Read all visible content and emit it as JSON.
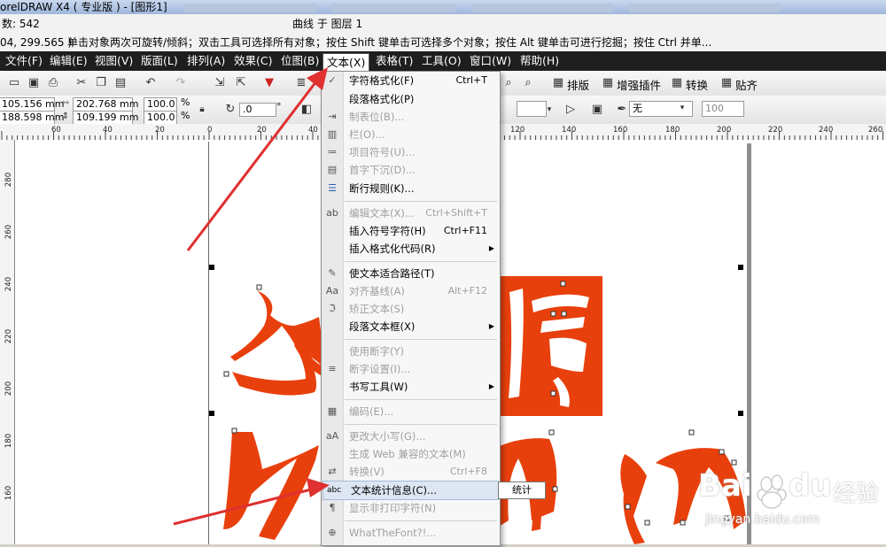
{
  "window": {
    "title": "orelDRAW X4 ( 专业版 ) - [图形1]",
    "layer_status": "曲线 于 图层 1"
  },
  "status": {
    "count_label": "数: 542",
    "coords": "04, 299.565 )",
    "hint": "单击对象两次可旋转/倾斜；双击工具可选择所有对象；按住 Shift 键单击可选择多个对象；按住 Alt 键单击可进行挖掘；按住 Ctrl 并单..."
  },
  "menubar": {
    "items": [
      "文件(F)",
      "编辑(E)",
      "视图(V)",
      "版面(L)",
      "排列(A)",
      "效果(C)",
      "位图(B)",
      "文本(X)",
      "表格(T)",
      "工具(O)",
      "窗口(W)",
      "帮助(H)"
    ],
    "active": "文本(X)"
  },
  "toolbar1": {
    "plugin_labels": [
      "排版",
      "增强插件",
      "转换",
      "贴齐"
    ]
  },
  "propbar": {
    "x": "105.156 mm",
    "y": "188.598 mm",
    "width": "202.768 mm",
    "height": "109.199 mm",
    "scale_x": "100.0",
    "scale_y": "100.0",
    "percent": "%",
    "rotation": ".0",
    "degree": "°",
    "outline_value": "无",
    "opacity_value": "100"
  },
  "ruler": {
    "h_labels": [
      "60",
      "40",
      "20",
      "0",
      "20",
      "40",
      "120",
      "140",
      "160",
      "180",
      "200",
      "220",
      "240",
      "260"
    ],
    "v_labels": [
      "280",
      "260",
      "240",
      "220",
      "200",
      "180",
      "160"
    ]
  },
  "text_menu": {
    "items": [
      {
        "label": "字符格式化(F)",
        "shortcut": "Ctrl+T",
        "disabled": false,
        "icon": "check-icon"
      },
      {
        "label": "段落格式化(P)",
        "shortcut": "",
        "disabled": false,
        "icon": ""
      },
      {
        "label": "制表位(B)...",
        "shortcut": "",
        "disabled": true,
        "icon": "tab-icon"
      },
      {
        "label": "栏(O)...",
        "shortcut": "",
        "disabled": true,
        "icon": "columns-icon"
      },
      {
        "label": "项目符号(U)...",
        "shortcut": "",
        "disabled": true,
        "icon": "bullets-icon"
      },
      {
        "label": "首字下沉(D)...",
        "shortcut": "",
        "disabled": true,
        "icon": "dropcap-icon"
      },
      {
        "label": "断行规则(K)...",
        "shortcut": "",
        "disabled": false,
        "icon": "linebreak-icon"
      },
      {
        "label": "编辑文本(X)...",
        "shortcut": "Ctrl+Shift+T",
        "disabled": true,
        "icon": "edit-text-icon"
      },
      {
        "label": "插入符号字符(H)",
        "shortcut": "Ctrl+F11",
        "disabled": false,
        "icon": ""
      },
      {
        "label": "插入格式化代码(R)",
        "shortcut": "",
        "disabled": false,
        "icon": "",
        "submenu": true
      },
      {
        "label": "使文本适合路径(T)",
        "shortcut": "",
        "disabled": false,
        "icon": "fit-path-icon"
      },
      {
        "label": "对齐基线(A)",
        "shortcut": "Alt+F12",
        "disabled": true,
        "icon": "baseline-icon"
      },
      {
        "label": "矫正文本(S)",
        "shortcut": "",
        "disabled": true,
        "icon": "straighten-icon"
      },
      {
        "label": "段落文本框(X)",
        "shortcut": "",
        "disabled": false,
        "icon": "",
        "submenu": true
      },
      {
        "label": "使用断字(Y)",
        "shortcut": "",
        "disabled": true,
        "icon": ""
      },
      {
        "label": "断字设置(I)...",
        "shortcut": "",
        "disabled": true,
        "icon": "hyphen-icon"
      },
      {
        "label": "书写工具(W)",
        "shortcut": "",
        "disabled": false,
        "icon": "",
        "submenu": true
      },
      {
        "label": "编码(E)...",
        "shortcut": "",
        "disabled": true,
        "icon": "encoding-icon"
      },
      {
        "label": "更改大小写(G)...",
        "shortcut": "",
        "disabled": true,
        "icon": "case-icon"
      },
      {
        "label": "生成 Web 兼容的文本(M)",
        "shortcut": "",
        "disabled": true,
        "icon": ""
      },
      {
        "label": "转换(V)",
        "shortcut": "Ctrl+F8",
        "disabled": true,
        "icon": "convert-icon"
      },
      {
        "label": "文本统计信息(C)...",
        "shortcut": "",
        "disabled": false,
        "icon": "abc-icon",
        "highlighted": true
      },
      {
        "label": "显示非打印字符(N)",
        "shortcut": "",
        "disabled": true,
        "icon": "pilcrow-icon"
      },
      {
        "label": "WhatTheFont?!...",
        "shortcut": "",
        "disabled": true,
        "icon": "whatthefont-icon"
      }
    ]
  },
  "tooltip": "统计",
  "watermark": {
    "brand": "Bai",
    "brand2": "du",
    "cn": "经验",
    "url": "jingyan.baidu.com"
  },
  "colors": {
    "calligraphy_red": "#e8400c",
    "menubar_bg": "#1e1e1e",
    "arrow_red": "#e03030"
  }
}
